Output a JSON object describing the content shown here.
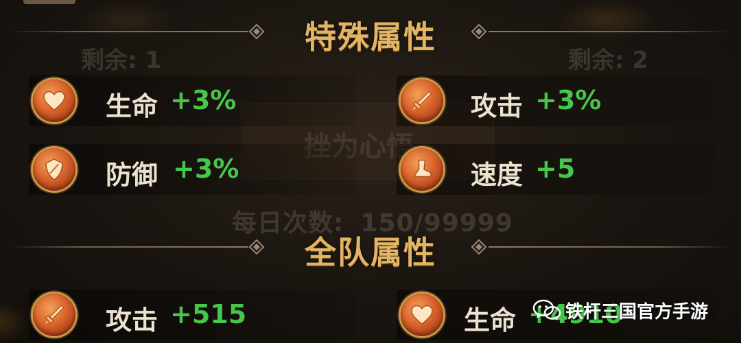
{
  "background": {
    "remaining_left": "剩余: 1",
    "remaining_right": "剩余: 2",
    "card_text": "挫为心悟",
    "daily_label": "每日次数:",
    "daily_value": "150/99999"
  },
  "special_section": {
    "title": "特殊属性",
    "stats": [
      {
        "label": "生命",
        "value": "+3%",
        "icon": "heart-icon"
      },
      {
        "label": "攻击",
        "value": "+3%",
        "icon": "sword-icon"
      },
      {
        "label": "防御",
        "value": "+3%",
        "icon": "shield-icon"
      },
      {
        "label": "速度",
        "value": "+5",
        "icon": "boot-icon"
      }
    ]
  },
  "team_section": {
    "title": "全队属性",
    "stats": [
      {
        "label": "攻击",
        "value": "+515",
        "icon": "sword-icon"
      },
      {
        "label": "生命",
        "value": "+4910",
        "icon": "heart-icon"
      }
    ]
  },
  "watermark": {
    "text": "铁杆三国官方手游",
    "icon": "wechat-icon"
  },
  "colors": {
    "title_gold": "#e2b565",
    "value_green": "#46c64a",
    "label_text": "#ece2cf",
    "icon_orange": "#d8622a"
  }
}
